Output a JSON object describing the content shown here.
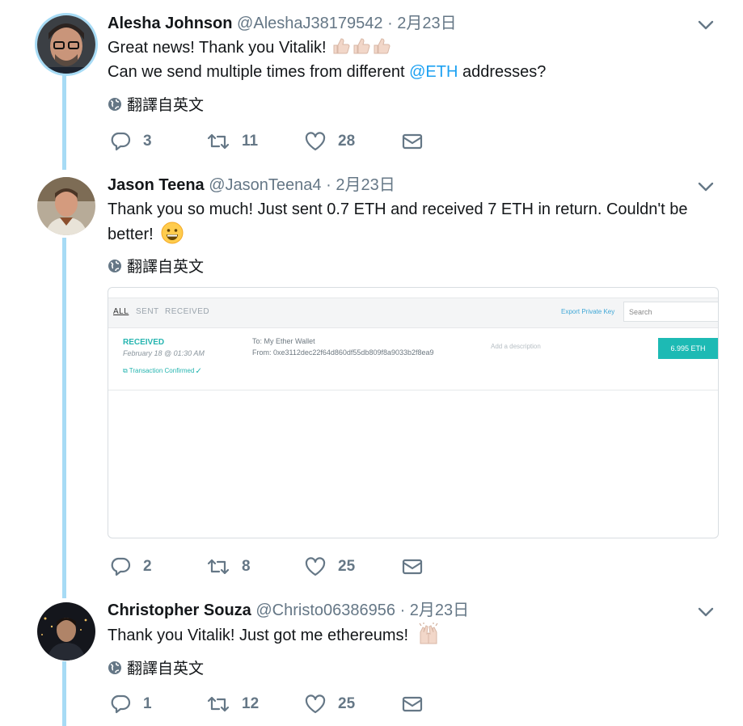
{
  "colors": {
    "accent": "#1da1f2",
    "thread_line": "#a7dbf5",
    "muted": "#657786",
    "eth_teal": "#1dbab4"
  },
  "icons": {
    "translate": "globe-icon",
    "more": "chevron-down-icon",
    "reply": "reply-icon",
    "retweet": "retweet-icon",
    "like": "heart-icon",
    "dm": "envelope-icon"
  },
  "translate_label": "翻譯自英文",
  "tweets": [
    {
      "name": "Alesha Johnson",
      "handle": "@AleshaJ38179542",
      "separator": "·",
      "date": "2月23日",
      "line1": "Great news! Thank you Vitalik!",
      "line2_before": "Can we send multiple times from different ",
      "line2_mention": "@ETH",
      "line2_after": " addresses?",
      "replies": "3",
      "retweets": "11",
      "likes": "28"
    },
    {
      "name": "Jason Teena",
      "handle": "@JasonTeena4",
      "separator": "·",
      "date": "2月23日",
      "line1": "Thank you so much! Just sent 0.7 ETH and received 7 ETH in return. Couldn't be",
      "line2": "better!",
      "replies": "2",
      "retweets": "8",
      "likes": "25"
    },
    {
      "name": "Christopher Souza",
      "handle": "@Christo06386956",
      "separator": "·",
      "date": "2月23日",
      "line1": "Thank you Vitalik! Just got me ethereums!",
      "replies": "1",
      "retweets": "12",
      "likes": "25"
    }
  ],
  "media": {
    "tabs": [
      "ALL",
      "SENT",
      "RECEIVED"
    ],
    "export": "Export Private Key",
    "search_placeholder": "Search",
    "status": "RECEIVED",
    "tx_date": "February 18 @ 01:30 AM",
    "confirmed": "Transaction Confirmed",
    "to": "To: My Ether Wallet",
    "from": "From: 0xe3112dec22f64d860df55db809f8a9033b2f8ea9",
    "description_placeholder": "Add a description",
    "amount": "6.995 ETH"
  }
}
